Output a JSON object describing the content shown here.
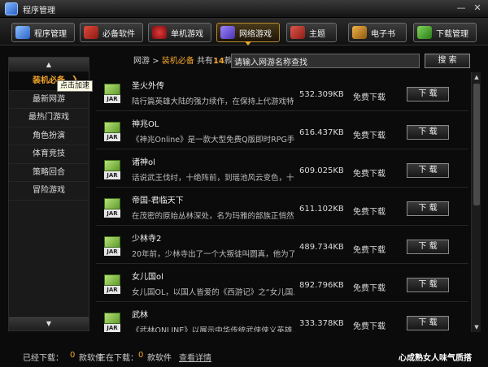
{
  "window": {
    "title": "程序管理",
    "minimize": "—",
    "close": "✕"
  },
  "toolbar": {
    "buttons": [
      {
        "label": "程序管理",
        "icon": "program-manager-icon",
        "color": "#3b7fd8"
      },
      {
        "label": "必备软件",
        "icon": "hot-software-icon",
        "color": "#c0392b"
      },
      {
        "label": "单机游戏",
        "icon": "gamepad-icon",
        "color": "#b01c1c"
      },
      {
        "label": "网络游戏",
        "icon": "online-game-icon",
        "color": "#6a4fd0"
      },
      {
        "label": "主题",
        "icon": "theme-shirt-icon",
        "color": "#b8322a"
      },
      {
        "label": "电子书",
        "icon": "ebook-icon",
        "color": "#b87a1a"
      },
      {
        "label": "下载管理",
        "icon": "download-arrow-icon",
        "color": "#3a9c2a"
      }
    ]
  },
  "sidebar": {
    "up": "▲",
    "down": "▼",
    "items": [
      {
        "label": "装机必备"
      },
      {
        "label": "最新网游"
      },
      {
        "label": "最热门游戏"
      },
      {
        "label": "角色扮演"
      },
      {
        "label": "体育竞技"
      },
      {
        "label": "策略回合"
      },
      {
        "label": "冒险游戏"
      }
    ],
    "tooltip": "点击加速"
  },
  "breadcrumb": {
    "root": "网游",
    "sep": " > ",
    "current": "装机必备",
    "total_prefix": "共有",
    "count": "14",
    "total_suffix": "款"
  },
  "search": {
    "value": "请输入网游名称查找",
    "button": "搜 索"
  },
  "games": [
    {
      "name": "圣火外传",
      "desc": "陆行篇英雄大陆的强力续作，在保持上代游戏特",
      "size": "532.309KB",
      "price": "免费下载",
      "btn": "下 载",
      "tag": "JAR"
    },
    {
      "name": "神兆OL",
      "desc": "《神兆Online》是一款大型免费Q版即时RPG手…",
      "size": "616.437KB",
      "price": "免费下载",
      "btn": "下 载",
      "tag": "JAR"
    },
    {
      "name": "诸神ol",
      "desc": "话说武王伐纣，十绝阵前，到瑶池风云变色，十…",
      "size": "609.025KB",
      "price": "免费下载",
      "btn": "下 载",
      "tag": "JAR"
    },
    {
      "name": "帝国-君临天下",
      "desc": "在茂密的原始丛林深处，名为玛雅的部族正悄然…",
      "size": "611.102KB",
      "price": "免费下载",
      "btn": "下 载",
      "tag": "JAR"
    },
    {
      "name": "少林寺2",
      "desc": "20年前，少林寺出了一个大叛徒叫圆真，他为了…",
      "size": "489.734KB",
      "price": "免费下载",
      "btn": "下 载",
      "tag": "JAR"
    },
    {
      "name": "女儿国ol",
      "desc": "女儿国OL，以国人皆爱的《西游记》之“女儿国…",
      "size": "892.796KB",
      "price": "免费下载",
      "btn": "下 载",
      "tag": "JAR"
    },
    {
      "name": "武林",
      "desc": "《武林ONLINE》以展示中华传统武侠侠义英雄…",
      "size": "333.378KB",
      "price": "免费下载",
      "btn": "下 载",
      "tag": "JAR"
    }
  ],
  "status": {
    "downloaded_label": "已经下载：",
    "downloaded_count": "0",
    "downloaded_unit": "款软件",
    "downloading_label": "正在下载：",
    "downloading_count": "0",
    "downloading_unit": "款软件",
    "details_link": "查看详情",
    "ad_text": "心成熟女人味气质搭"
  },
  "colors": {
    "accent": "#f3a52c",
    "background": "#0b0b0b"
  }
}
